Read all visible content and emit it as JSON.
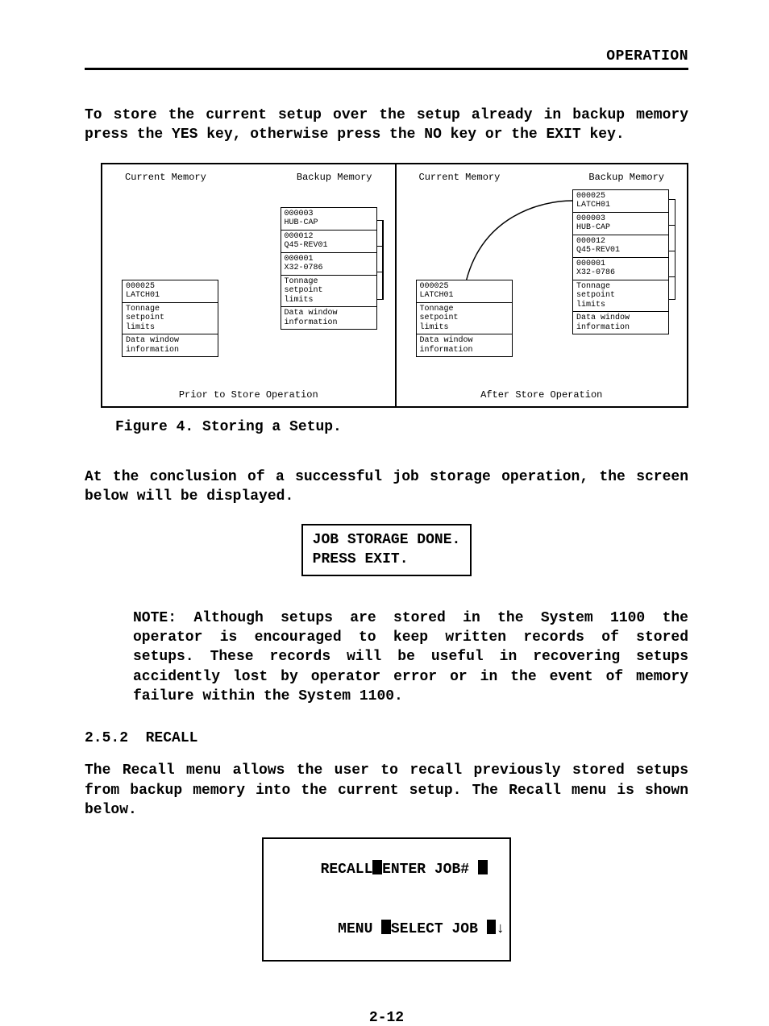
{
  "header": "OPERATION",
  "para1": "To store the current setup over the setup already in backup memory press the YES key, otherwise press the NO key or the EXIT key.",
  "figure": {
    "col_titles": {
      "current": "Current Memory",
      "backup": "Backup Memory"
    },
    "slots": {
      "j25": {
        "id": "000025",
        "name": "LATCH01"
      },
      "j03": {
        "id": "000003",
        "name": "HUB-CAP"
      },
      "j12": {
        "id": "000012",
        "name": "Q45-REV01"
      },
      "j01": {
        "id": "000001",
        "name": "X32-0786"
      },
      "ton": "Tonnage\nsetpoint\nlimits",
      "dw": "Data window\ninformation"
    },
    "caption_prior": "Prior to Store Operation",
    "caption_after": "After Store Operation",
    "caption": "Figure 4.  Storing a Setup."
  },
  "para2": "At the conclusion of a successful job storage operation, the screen below will be displayed.",
  "screen1": {
    "line1": "JOB STORAGE DONE.",
    "line2": "PRESS EXIT."
  },
  "note": "NOTE:  Although setups are stored in the System 1100 the operator is encouraged to keep written records of stored setups.   These records will be useful in recovering setups accidently lost by operator error or in the event of memory failure within the System 1100.",
  "section_no": "2.5.2",
  "section_title": "RECALL",
  "para3": "The Recall menu allows the user to recall previously stored setups from backup memory into the current setup.   The Recall menu is shown below.",
  "screen2": {
    "l1a": "RECALL",
    "l1b": "ENTER JOB#",
    "l2a": "MENU",
    "l2b": "SELECT JOB",
    "arrow": "↓"
  },
  "pagenum": "2-12"
}
